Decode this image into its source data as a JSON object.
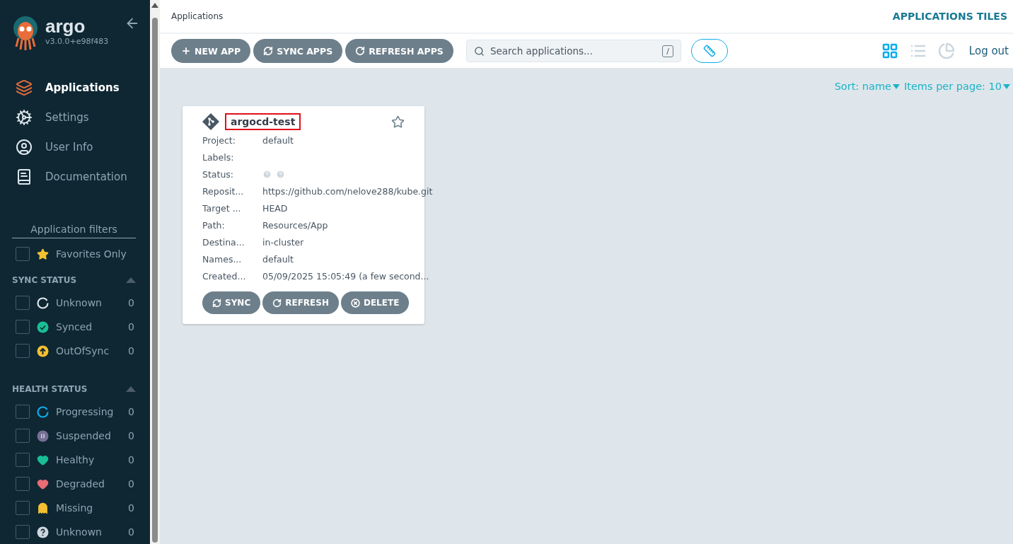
{
  "sidebar": {
    "logo_text": "argo",
    "version": "v3.0.0+e98f483",
    "nav": [
      {
        "label": "Applications",
        "selected": true
      },
      {
        "label": "Settings",
        "selected": false
      },
      {
        "label": "User Info",
        "selected": false
      },
      {
        "label": "Documentation",
        "selected": false
      }
    ],
    "filters_title": "Application filters",
    "favorites": {
      "label": "Favorites Only",
      "checked": false
    },
    "groups": [
      {
        "title": "SYNC STATUS",
        "expanded": true,
        "items": [
          {
            "label": "Unknown",
            "count": "0",
            "kind": "ring",
            "color": "#dee6eb",
            "checked": false
          },
          {
            "label": "Synced",
            "count": "0",
            "kind": "check",
            "color": "#18be94",
            "checked": false
          },
          {
            "label": "OutOfSync",
            "count": "0",
            "kind": "arrow",
            "color": "#f4c030",
            "checked": false
          }
        ]
      },
      {
        "title": "HEALTH STATUS",
        "expanded": true,
        "items": [
          {
            "label": "Progressing",
            "count": "0",
            "kind": "ring",
            "color": "#0dadea",
            "checked": false
          },
          {
            "label": "Suspended",
            "count": "0",
            "kind": "pause",
            "color": "#766f94",
            "checked": false
          },
          {
            "label": "Healthy",
            "count": "0",
            "kind": "heart",
            "color": "#18be94",
            "checked": false
          },
          {
            "label": "Degraded",
            "count": "0",
            "kind": "broken",
            "color": "#e96d76",
            "checked": false
          },
          {
            "label": "Missing",
            "count": "0",
            "kind": "ghost",
            "color": "#f4c030",
            "checked": false
          },
          {
            "label": "Unknown",
            "count": "0",
            "kind": "question",
            "color": "#ccd6dd",
            "checked": false
          }
        ]
      }
    ]
  },
  "header": {
    "breadcrumb": "Applications",
    "title": "APPLICATIONS TILES"
  },
  "toolbar": {
    "buttons": [
      {
        "label": "NEW APP"
      },
      {
        "label": "SYNC APPS"
      },
      {
        "label": "REFRESH APPS"
      }
    ],
    "search": {
      "placeholder": "Search applications...",
      "shortcut": "/"
    },
    "views": [
      {
        "selected": true
      },
      {
        "selected": false
      },
      {
        "selected": false
      }
    ],
    "logout": "Log out"
  },
  "sort": {
    "sort_label": "Sort: name",
    "per_page": "Items per page: 10"
  },
  "apps": [
    {
      "name": "argocd-test",
      "favorite": false,
      "fields": [
        {
          "label": "Project:",
          "value": "default"
        },
        {
          "label": "Labels:"
        },
        {
          "label": "Status:",
          "kind": "status"
        },
        {
          "label": "Reposit...",
          "value": "https://github.com/nelove288/kube.git"
        },
        {
          "label": "Target ...",
          "value": "HEAD"
        },
        {
          "label": "Path:",
          "value": "Resources/App"
        },
        {
          "label": "Destina...",
          "value": "in-cluster"
        },
        {
          "label": "Names...",
          "value": "default"
        },
        {
          "label": "Created...",
          "value": "05/09/2025 15:05:49  (a few second..."
        }
      ],
      "actions": [
        {
          "label": "SYNC"
        },
        {
          "label": "REFRESH"
        },
        {
          "label": "DELETE"
        }
      ]
    }
  ]
}
